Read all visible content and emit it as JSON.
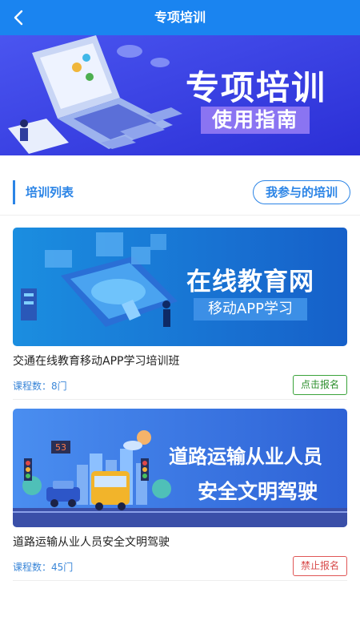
{
  "header": {
    "title": "专项培训"
  },
  "hero": {
    "title": "专项培训",
    "subtitle": "使用指南"
  },
  "section": {
    "title": "培训列表",
    "my_trainings_label": "我参与的培训"
  },
  "courses": [
    {
      "banner_title": "在线教育网",
      "banner_subtitle": "移动APP学习",
      "name": "交通在线教育移动APP学习培训班",
      "count_label": "课程数：8门",
      "action_label": "点击报名",
      "action_state": "open"
    },
    {
      "banner_title": "道路运输从业人员",
      "banner_subtitle": "安全文明驾驶",
      "name": "道路运输从业人员安全文明驾驶",
      "count_label": "课程数：45门",
      "action_label": "禁止报名",
      "action_state": "closed"
    }
  ],
  "banner_sign_number": "53",
  "colors": {
    "header": "#1a84f0",
    "accent": "#2b84e6",
    "enroll_open": "#3aa33a",
    "enroll_closed": "#e05656"
  }
}
